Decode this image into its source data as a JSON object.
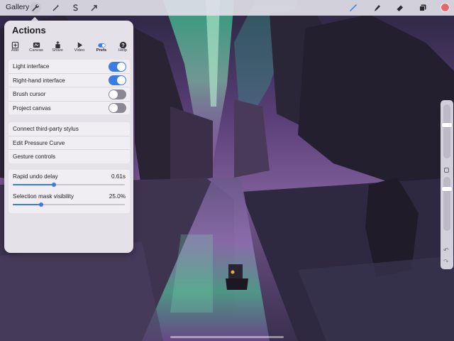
{
  "toolbar": {
    "gallery_label": "Gallery",
    "left_icons": [
      "wrench-icon",
      "magic-wand-icon",
      "s-selection-icon",
      "arrow-transform-icon"
    ],
    "right_icons": [
      "brush-icon",
      "smudge-icon",
      "eraser-icon",
      "layers-icon"
    ],
    "active_color": "#e5686e",
    "brush_color": "#3b7be6"
  },
  "actions": {
    "title": "Actions",
    "tabs": [
      {
        "label": "Add",
        "icon": "add-icon"
      },
      {
        "label": "Canvas",
        "icon": "canvas-icon"
      },
      {
        "label": "Share",
        "icon": "share-icon"
      },
      {
        "label": "Video",
        "icon": "video-play-icon"
      },
      {
        "label": "Prefs",
        "icon": "prefs-toggle-icon",
        "active": true
      },
      {
        "label": "Help",
        "icon": "help-icon"
      }
    ],
    "toggles": [
      {
        "label": "Light interface",
        "on": true
      },
      {
        "label": "Right-hand interface",
        "on": true
      },
      {
        "label": "Brush cursor",
        "on": false
      },
      {
        "label": "Project canvas",
        "on": false
      }
    ],
    "links": [
      {
        "label": "Connect third-party stylus"
      },
      {
        "label": "Edit Pressure Curve"
      },
      {
        "label": "Gesture controls"
      }
    ],
    "sliders": [
      {
        "label": "Rapid undo delay",
        "value": "0.61s",
        "level": 0.37
      },
      {
        "label": "Selection mask visibility",
        "value": "25.0%",
        "level": 0.25
      }
    ]
  },
  "sidebar": {
    "brush_size_level": 0.35,
    "opacity_level": 0.18,
    "undo_icon": "undo-icon",
    "redo_icon": "redo-icon",
    "modify_icon": "square-modify-icon"
  },
  "colors": {
    "accent": "#3b7be6",
    "panel_bg": "#e4e1e9",
    "toggle_off": "#8c8893"
  }
}
